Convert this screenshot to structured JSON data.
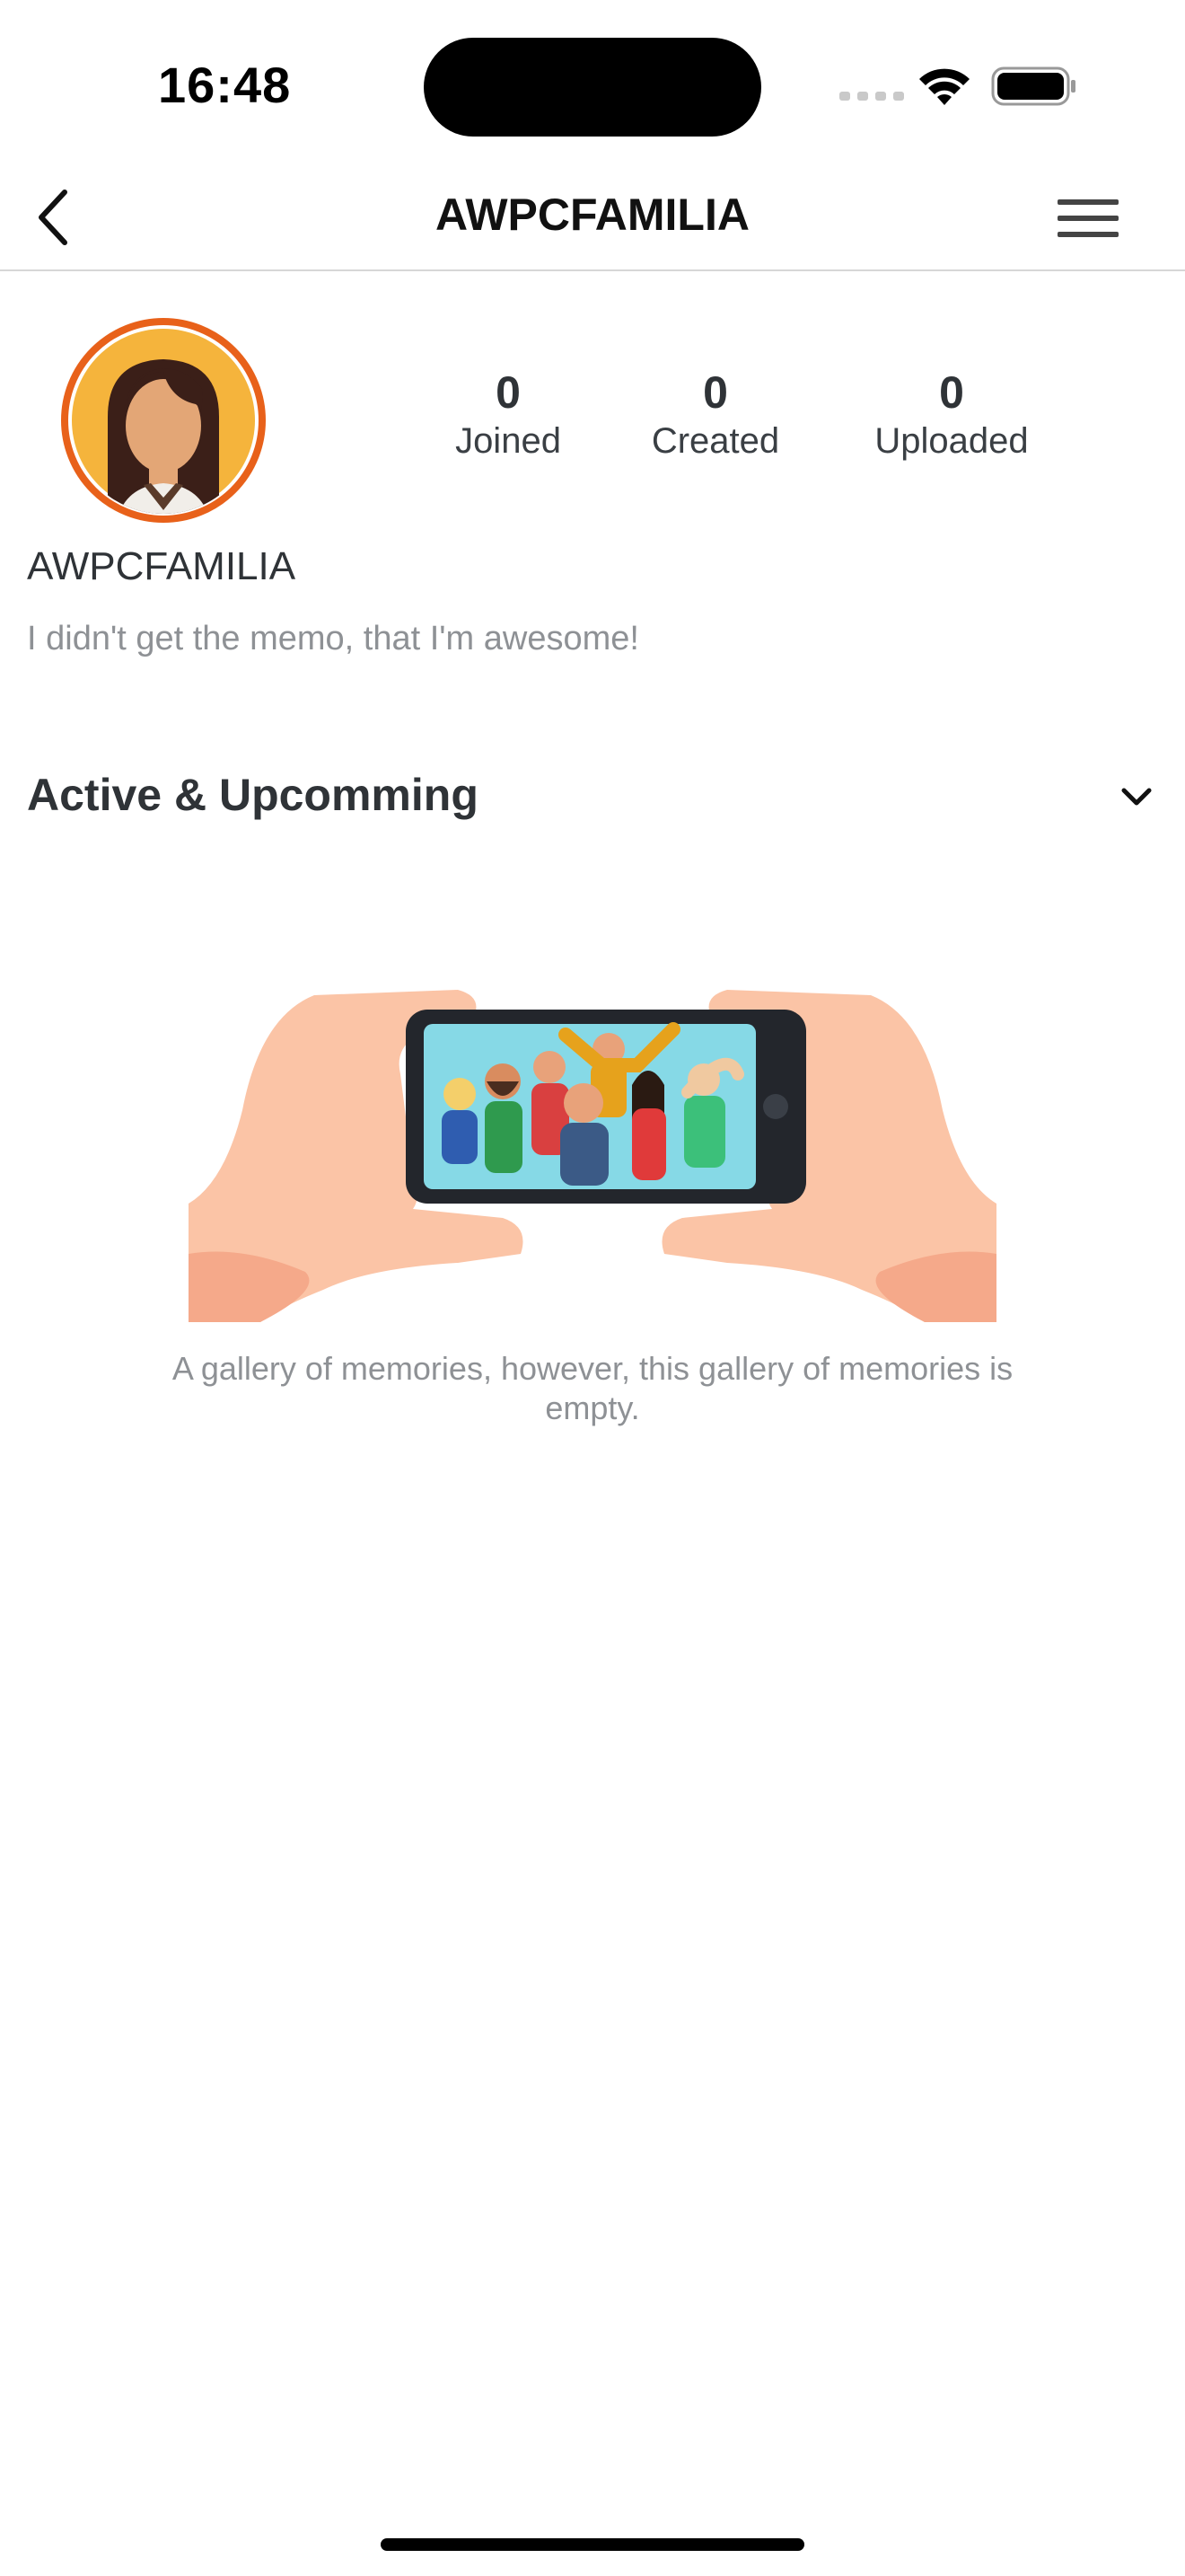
{
  "status_bar": {
    "time": "16:48",
    "signal_icon": "cellular-signal-icon",
    "wifi_icon": "wifi-icon",
    "battery_icon": "battery-icon"
  },
  "nav": {
    "title": "AWPCFAMILIA",
    "back_icon": "chevron-left-icon",
    "menu_icon": "hamburger-menu-icon"
  },
  "profile": {
    "avatar_icon": "user-avatar-icon",
    "username": "AWPCFAMILIA",
    "bio": "I didn't get the memo, that I'm awesome!",
    "stats": [
      {
        "value": "0",
        "label": "Joined"
      },
      {
        "value": "0",
        "label": "Created"
      },
      {
        "value": "0",
        "label": "Uploaded"
      }
    ]
  },
  "section": {
    "title": "Active & Upcomming",
    "toggle_icon": "chevron-down-icon"
  },
  "empty_state": {
    "illustration": "hands-holding-phone-group-photo-illustration",
    "message": "A gallery of memories, however, this gallery of memories is empty."
  },
  "colors": {
    "avatar_ring": "#e8611a",
    "avatar_bg": "#f5b43c",
    "text_primary": "#2f3337",
    "text_muted": "#8e9195"
  }
}
